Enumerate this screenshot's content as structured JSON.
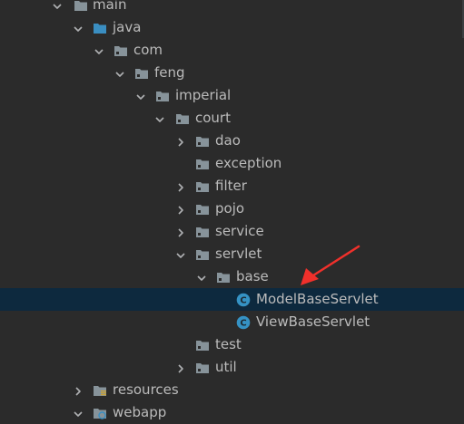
{
  "tree": {
    "rows": [
      {
        "label": "main",
        "icon": "folder-icon",
        "arrow": "down"
      },
      {
        "label": "java",
        "icon": "source-root-folder-icon",
        "arrow": "down"
      },
      {
        "label": "com",
        "icon": "package-icon",
        "arrow": "down"
      },
      {
        "label": "feng",
        "icon": "package-icon",
        "arrow": "down"
      },
      {
        "label": "imperial",
        "icon": "package-icon",
        "arrow": "down"
      },
      {
        "label": "court",
        "icon": "package-icon",
        "arrow": "down"
      },
      {
        "label": "dao",
        "icon": "package-icon",
        "arrow": "right"
      },
      {
        "label": "exception",
        "icon": "package-icon",
        "arrow": "none"
      },
      {
        "label": "filter",
        "icon": "package-icon",
        "arrow": "right"
      },
      {
        "label": "pojo",
        "icon": "package-icon",
        "arrow": "right"
      },
      {
        "label": "service",
        "icon": "package-icon",
        "arrow": "right"
      },
      {
        "label": "servlet",
        "icon": "package-icon",
        "arrow": "down"
      },
      {
        "label": "base",
        "icon": "package-icon",
        "arrow": "down"
      },
      {
        "label": "ModelBaseServlet",
        "icon": "java-class-icon",
        "arrow": "none",
        "selected": true
      },
      {
        "label": "ViewBaseServlet",
        "icon": "java-class-icon",
        "arrow": "none"
      },
      {
        "label": "test",
        "icon": "package-icon",
        "arrow": "none"
      },
      {
        "label": "util",
        "icon": "package-icon",
        "arrow": "right"
      },
      {
        "label": "resources",
        "icon": "resources-folder-icon",
        "arrow": "right"
      },
      {
        "label": "webapp",
        "icon": "web-folder-icon",
        "arrow": "down"
      }
    ]
  },
  "colors": {
    "background": "#2b2b2b",
    "text": "#bbbbbb",
    "selection": "#0d293e",
    "folder": "#87939a",
    "source_folder": "#3a8ec1",
    "class_icon": "#3592c4",
    "annotation_arrow": "#f0302b"
  },
  "annotation": {
    "type": "red-arrow",
    "points_to": "ModelBaseServlet"
  }
}
